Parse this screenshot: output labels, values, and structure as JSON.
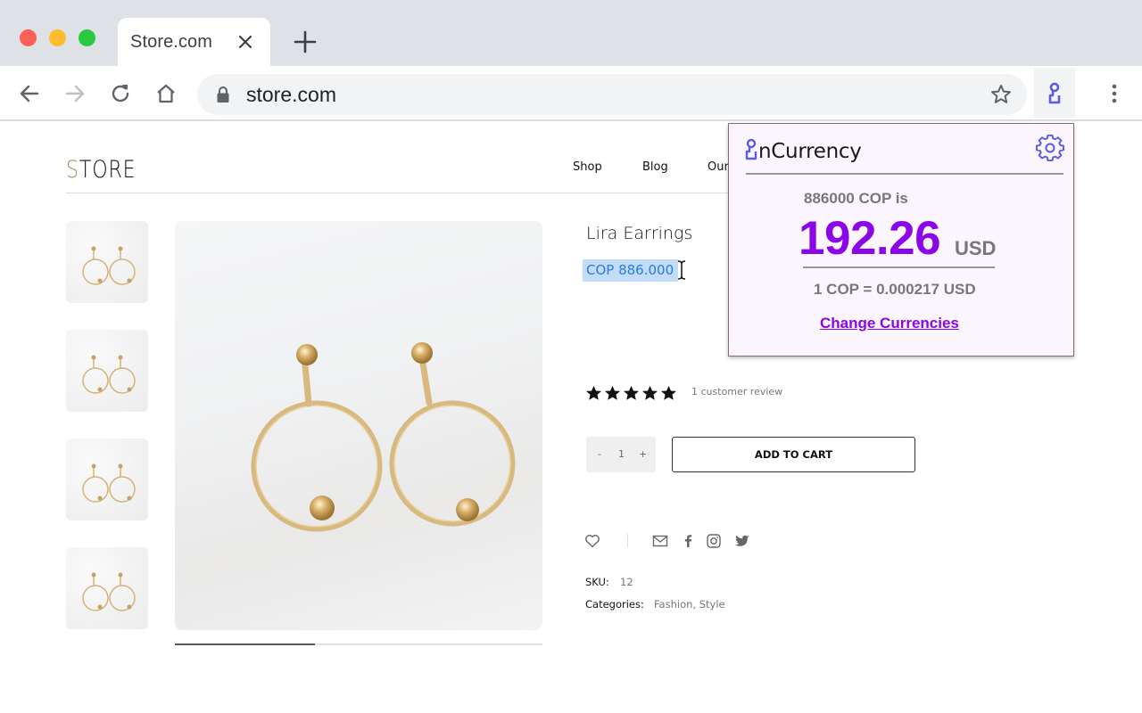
{
  "browser": {
    "tab_title": "Store.com",
    "url": "store.com",
    "extension_name": "inCurrency"
  },
  "store": {
    "logo_first": "S",
    "logo_rest": "TORE",
    "nav": [
      "Shop",
      "Blog",
      "Our"
    ],
    "gallery_progress": 0.38,
    "product": {
      "title": "Lira Earrings",
      "price": "COP 886.000",
      "rating": 5,
      "rating_max": 5,
      "review_count": "1 customer review",
      "quantity": "1",
      "qty_minus": "-",
      "qty_plus": "+",
      "add_to_cart": "ADD TO CART",
      "sku_label": "SKU:",
      "sku_value": "12",
      "categories_label": "Categories:",
      "categories_value": "Fashion, Style"
    },
    "share_icons": [
      "heart-icon",
      "email-icon",
      "facebook-icon",
      "instagram-icon",
      "twitter-icon"
    ]
  },
  "popup": {
    "logo_text": "nCurrency",
    "from_text": "886000 COP is",
    "amount": "192.26",
    "to_currency": "USD",
    "rate_text": "1 COP = 0.000217 USD",
    "change_link": "Change Currencies",
    "accent_color": "#8a05e8",
    "icon_color": "#5b5ce6"
  }
}
